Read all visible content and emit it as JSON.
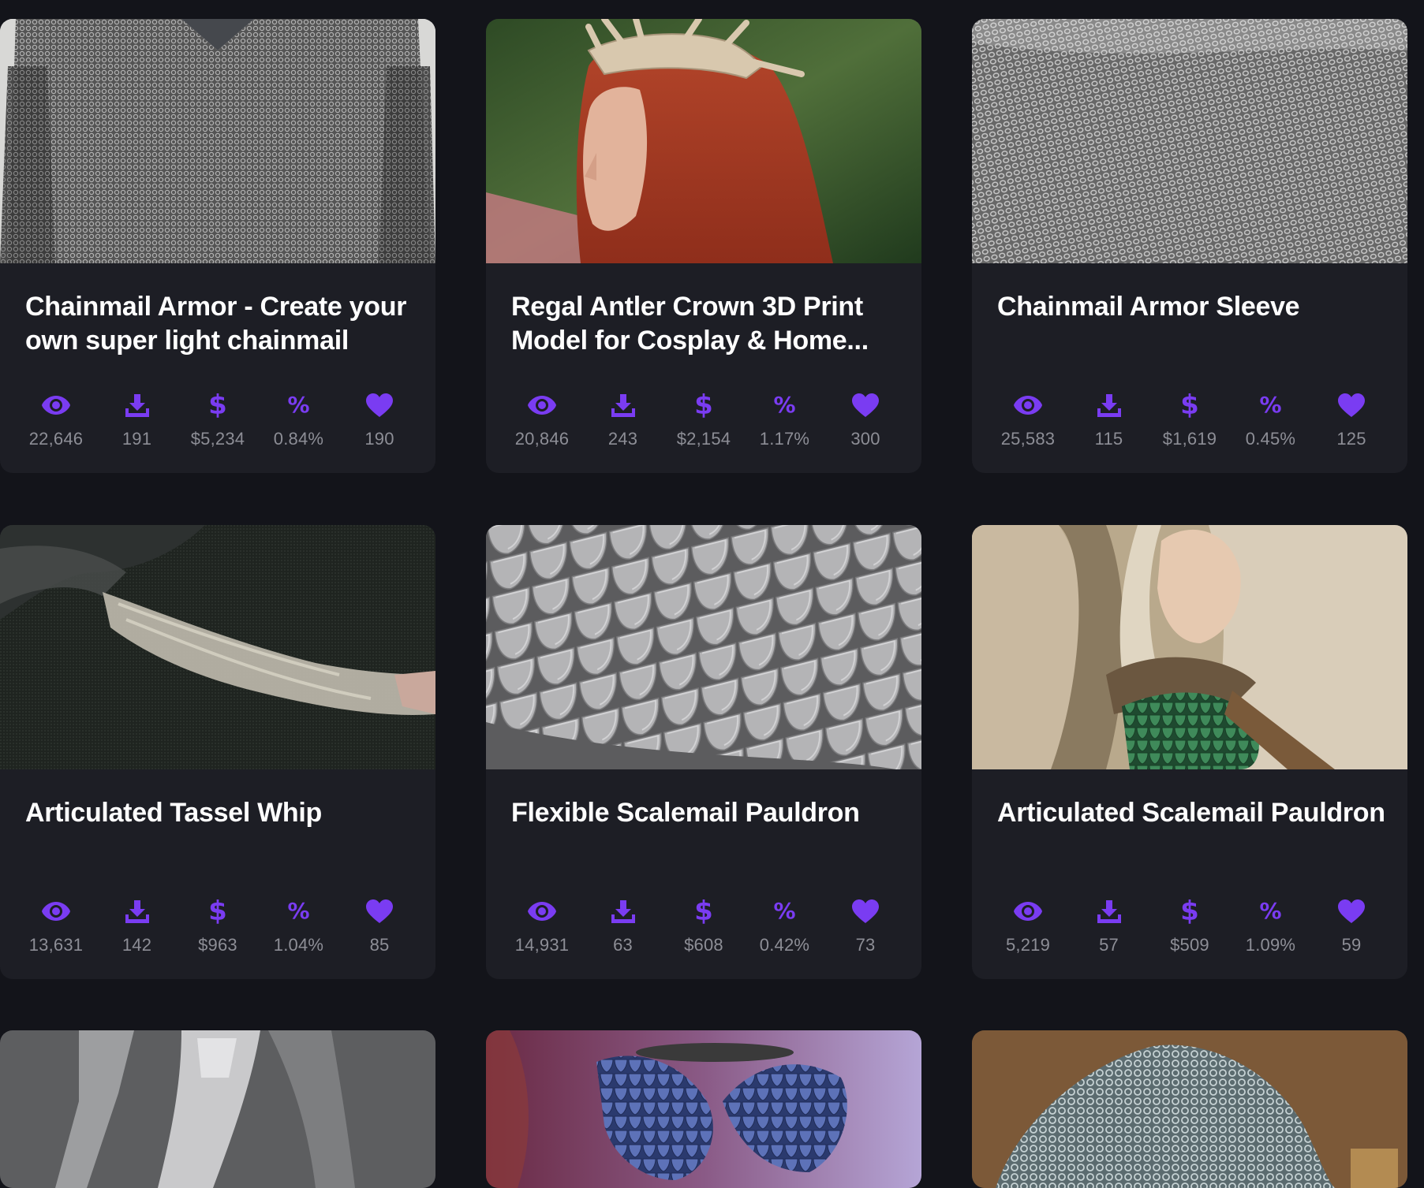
{
  "colors": {
    "page_bg": "#13141a",
    "card_bg": "#1d1e25",
    "accent": "#7a3cf2",
    "stat_text": "#8d8e96",
    "title_text": "#ffffff"
  },
  "icons": {
    "views": "eye-icon",
    "downloads": "download-icon",
    "earnings": "dollar-icon",
    "conversion": "percent-icon",
    "likes": "heart-icon"
  },
  "cards": [
    {
      "title": "Chainmail Armor - Create your own super light chainmail",
      "image": "chainmail-shirt-thumbnail",
      "stats": {
        "views": "22,646",
        "downloads": "191",
        "earnings": "$5,234",
        "conversion": "0.84%",
        "likes": "190"
      }
    },
    {
      "title": "Regal Antler Crown 3D Print Model for Cosplay & Home...",
      "image": "antler-crown-thumbnail",
      "stats": {
        "views": "20,846",
        "downloads": "243",
        "earnings": "$2,154",
        "conversion": "1.17%",
        "likes": "300"
      }
    },
    {
      "title": "Chainmail Armor Sleeve",
      "image": "chainmail-sleeve-thumbnail",
      "stats": {
        "views": "25,583",
        "downloads": "115",
        "earnings": "$1,619",
        "conversion": "0.45%",
        "likes": "125"
      }
    },
    {
      "title": "Articulated Tassel Whip",
      "image": "tassel-whip-thumbnail",
      "stats": {
        "views": "13,631",
        "downloads": "142",
        "earnings": "$963",
        "conversion": "1.04%",
        "likes": "85"
      }
    },
    {
      "title": "Flexible Scalemail Pauldron",
      "image": "scalemail-render-thumbnail",
      "stats": {
        "views": "14,931",
        "downloads": "63",
        "earnings": "$608",
        "conversion": "0.42%",
        "likes": "73"
      }
    },
    {
      "title": "Articulated Scalemail Pauldron",
      "image": "scalemail-pauldron-thumbnail",
      "stats": {
        "views": "5,219",
        "downloads": "57",
        "earnings": "$509",
        "conversion": "1.09%",
        "likes": "59"
      }
    },
    {
      "image": "armor-render-thumbnail"
    },
    {
      "image": "dragon-scale-top-thumbnail"
    },
    {
      "image": "chainmail-pile-thumbnail"
    }
  ]
}
